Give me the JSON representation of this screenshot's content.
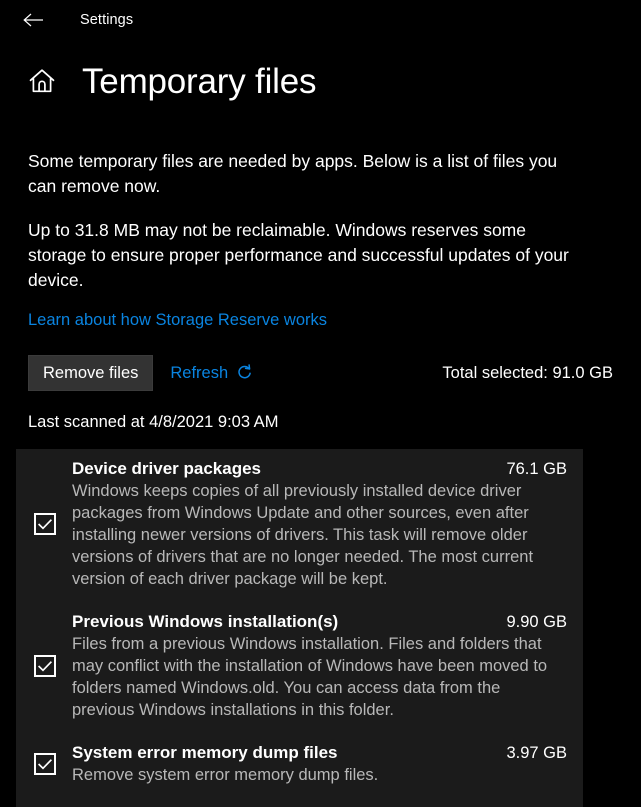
{
  "titlebar": {
    "back_icon": "back-arrow-icon",
    "app_title": "Settings"
  },
  "header": {
    "home_icon": "home-icon",
    "page_title": "Temporary files"
  },
  "description": {
    "paragraph1": "Some temporary files are needed by apps. Below is a list of files you can remove now.",
    "paragraph2": "Up to 31.8 MB may not be reclaimable. Windows reserves some storage to ensure proper performance and successful updates of your device.",
    "learn_link": "Learn about how Storage Reserve works"
  },
  "actions": {
    "remove_files_label": "Remove files",
    "refresh_label": "Refresh",
    "refresh_icon": "refresh-circular-arrow-icon",
    "total_selected": "Total selected: 91.0 GB",
    "last_scanned": "Last scanned at 4/8/2021 9:03 AM"
  },
  "file_list": [
    {
      "checked": true,
      "name": "Device driver packages",
      "size": "76.1 GB",
      "description": "Windows keeps copies of all previously installed device driver packages from Windows Update and other sources, even after installing newer versions of drivers. This task will remove older versions of drivers that are no longer needed. The most current version of each driver package will be kept."
    },
    {
      "checked": true,
      "name": "Previous Windows installation(s)",
      "size": "9.90 GB",
      "description": "Files from a previous Windows installation.  Files and folders that may conflict with the installation of Windows have been moved to folders named Windows.old.  You can access data from the previous Windows installations in this folder."
    },
    {
      "checked": true,
      "name": "System error memory dump files",
      "size": "3.97 GB",
      "description": "Remove system error memory dump files."
    }
  ],
  "colors": {
    "background": "#000000",
    "panel": "#1b1b1b",
    "accent_link": "#0a84e0",
    "button_face": "#333333",
    "description_text": "#b8b8b8"
  }
}
